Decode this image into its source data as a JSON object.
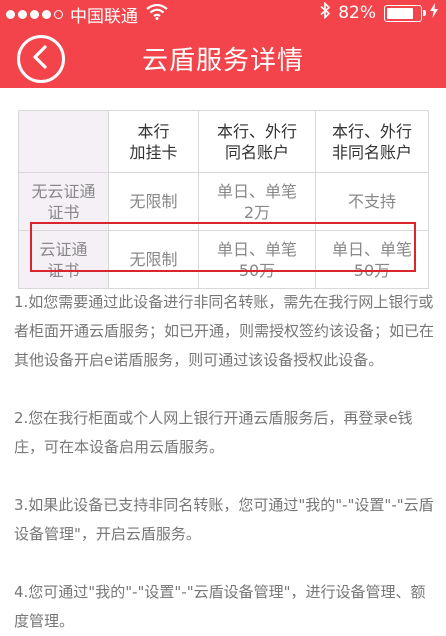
{
  "status_bar": {
    "carrier": "中国联通",
    "battery_percent": "82%",
    "battery_level": 0.82,
    "icons": [
      "signal-dots-icon",
      "wifi-icon",
      "bluetooth-icon",
      "battery-icon",
      "charging-icon"
    ]
  },
  "header": {
    "title": "云盾服务详情",
    "back_icon": "chevron-left-icon",
    "background_color": "#f2444a"
  },
  "table": {
    "columns": [
      "",
      "本行\n加挂卡",
      "本行、外行\n同名账户",
      "本行、外行\n非同名账户"
    ],
    "rows": [
      {
        "label": "无云证通\n证书",
        "cells": [
          "无限制",
          "单日、单笔\n2万",
          "不支持"
        ]
      },
      {
        "label": "云证通\n证书",
        "cells": [
          "无限制",
          "单日、单笔\n50万",
          "单日、单笔\n50万"
        ]
      }
    ],
    "highlight_color": "#d9252b"
  },
  "notes": [
    "1.如您需要通过此设备进行非同名转账，需先在我行网上银行或者柜面开通云盾服务；如已开通，则需授权签约该设备；如已在其他设备开启e诺盾服务，则可通过该设备授权此设备。",
    "2.您在我行柜面或个人网上银行开通云盾服务后，再登录e钱庄，可在本设备启用云盾服务。",
    "3.如果此设备已支持非同名转账，您可通过\"我的\"-\"设置\"-\"云盾设备管理\"，开启云盾服务。",
    "4.您可通过\"我的\"-\"设置\"-\"云盾设备管理\"，进行设备管理、额度管理。"
  ]
}
